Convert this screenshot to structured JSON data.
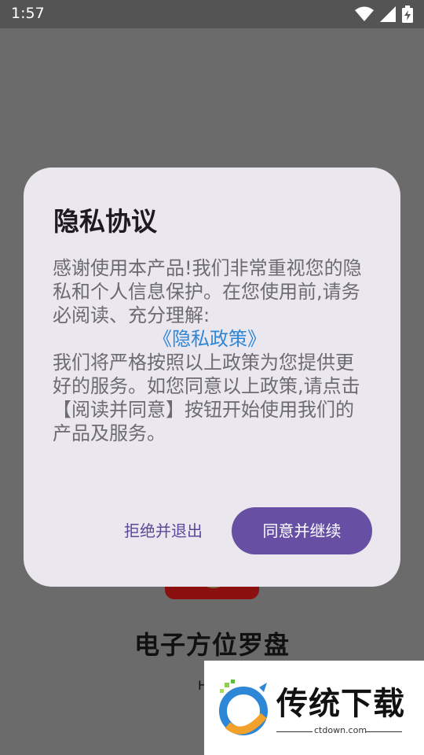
{
  "status_bar": {
    "time": "1:57",
    "icons": [
      "wifi-icon",
      "signal-icon",
      "battery-charging-icon"
    ]
  },
  "background_app": {
    "title": "电子方位罗盘",
    "subtitle_fragment": "H"
  },
  "dialog": {
    "title": "隐私协议",
    "body_intro": "感谢使用本产品!我们非常重视您的隐私和个人信息保护。在您使用前,请务必阅读、充分理解:",
    "policy_link": "《隐私政策》",
    "body_outro": "我们将严格按照以上政策为您提供更好的服务。如您同意以上政策,请点击【阅读并同意】按钮开始使用我们的产品及服务。",
    "reject_label": "拒绝并退出",
    "agree_label": "同意并继续"
  },
  "watermark": {
    "brand": "传统下载",
    "url": "ctdown.com"
  },
  "colors": {
    "scrim": "#6b6b6b",
    "dialog_bg": "#ebe7ef",
    "primary": "#6750a4",
    "link": "#2e86d6"
  }
}
